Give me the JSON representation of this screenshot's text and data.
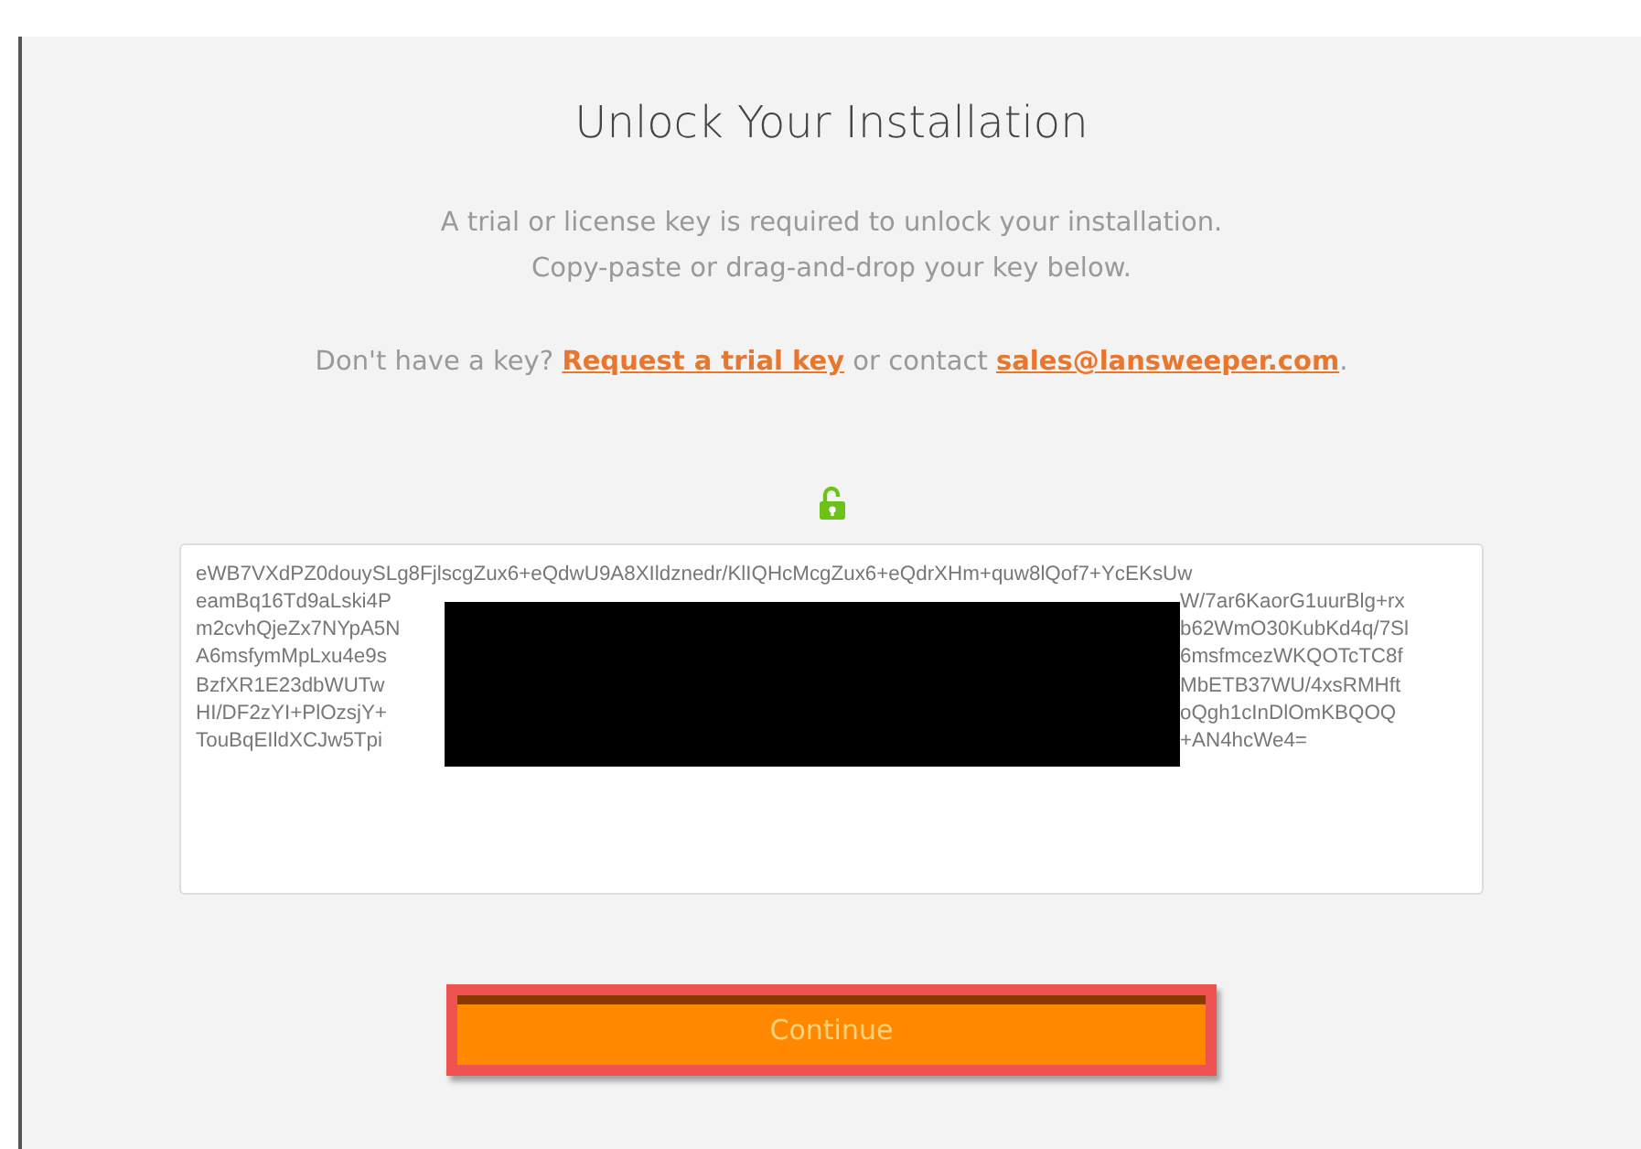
{
  "title": "Unlock Your Installation",
  "intro": [
    "A trial or license key is required to unlock your installation.",
    "Copy-paste or drag-and-drop your key below."
  ],
  "help": {
    "text_before": "Don't have a key?",
    "trial_link": "Request a trial key",
    "text_middle": "or contact",
    "email_link": "sales@lansweeper.com",
    "text_after": "."
  },
  "unlocked": true,
  "key_field": {
    "redacted": true,
    "lines": [
      {
        "left": "eWB7VXdPZ0douySLg8FjlscgZux6+eQdwU9A8XIldznedr/KlIQHcMcgZux6+eQdrXHm+quw8lQof7+YcEKsUw"
      },
      {
        "left": "eamBq16Td9aLski4P",
        "right": "W/7ar6KaorG1uurBlg+rx"
      },
      {
        "left": "m2cvhQjeZx7NYpA5N",
        "right": "b62WmO30KubKd4q/7Sl"
      },
      {
        "left": "A6msfymMpLxu4e9s",
        "right": "6msfmcezWKQOTcTC8f"
      },
      {
        "left": "BzfXR1E23dbWUTw",
        "right": "MbETB37WU/4xsRMHft"
      },
      {
        "left": "HI/DF2zYI+PlOzsjY+",
        "right": "oQgh1cInDlOmKBQOQ"
      },
      {
        "left": "TouBqEIldXCJw5Tpi",
        "right": "+AN4hcWe4="
      }
    ]
  },
  "continue_button": {
    "label": "Continue",
    "highlighted": true
  }
}
